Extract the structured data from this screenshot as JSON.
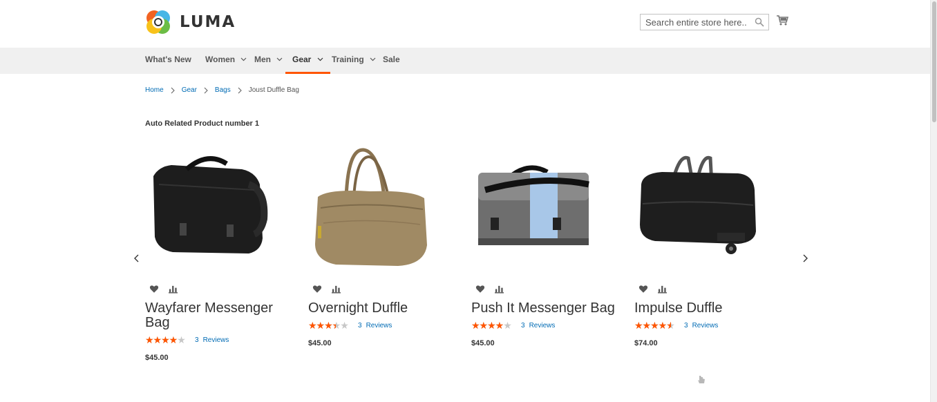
{
  "header": {
    "logo_text": "LUMA",
    "search_placeholder": "Search entire store here...",
    "cart_icon": "cart-icon"
  },
  "nav": {
    "items": [
      {
        "label": "What's New",
        "dropdown": false
      },
      {
        "label": "Women",
        "dropdown": true
      },
      {
        "label": "Men",
        "dropdown": true
      },
      {
        "label": "Gear",
        "dropdown": true,
        "active": true
      },
      {
        "label": "Training",
        "dropdown": true
      },
      {
        "label": "Sale",
        "dropdown": false
      }
    ]
  },
  "breadcrumb": [
    "Home",
    "Gear",
    "Bags",
    "Joust Duffle Bag"
  ],
  "block_title": "Auto Related Product number 1",
  "colors": {
    "accent": "#ff5501",
    "link": "#006bb4",
    "nav_bg": "#f0f0f0"
  },
  "products": [
    {
      "name": "Wayfarer Messenger Bag",
      "rating_pct": 70,
      "reviews_count": "3",
      "reviews_label": "Reviews",
      "price": "$45.00",
      "image": "black messenger bag"
    },
    {
      "name": "Overnight Duffle",
      "rating_pct": 60,
      "reviews_count": "3",
      "reviews_label": "Reviews",
      "price": "$45.00",
      "image": "tan duffle bag"
    },
    {
      "name": "Push It Messenger Bag",
      "rating_pct": 70,
      "reviews_count": "3",
      "reviews_label": "Reviews",
      "price": "$45.00",
      "image": "grey and light blue messenger bag"
    },
    {
      "name": "Impulse Duffle",
      "rating_pct": 80,
      "reviews_count": "3",
      "reviews_label": "Reviews",
      "price": "$74.00",
      "image": "black rolling duffle"
    }
  ]
}
